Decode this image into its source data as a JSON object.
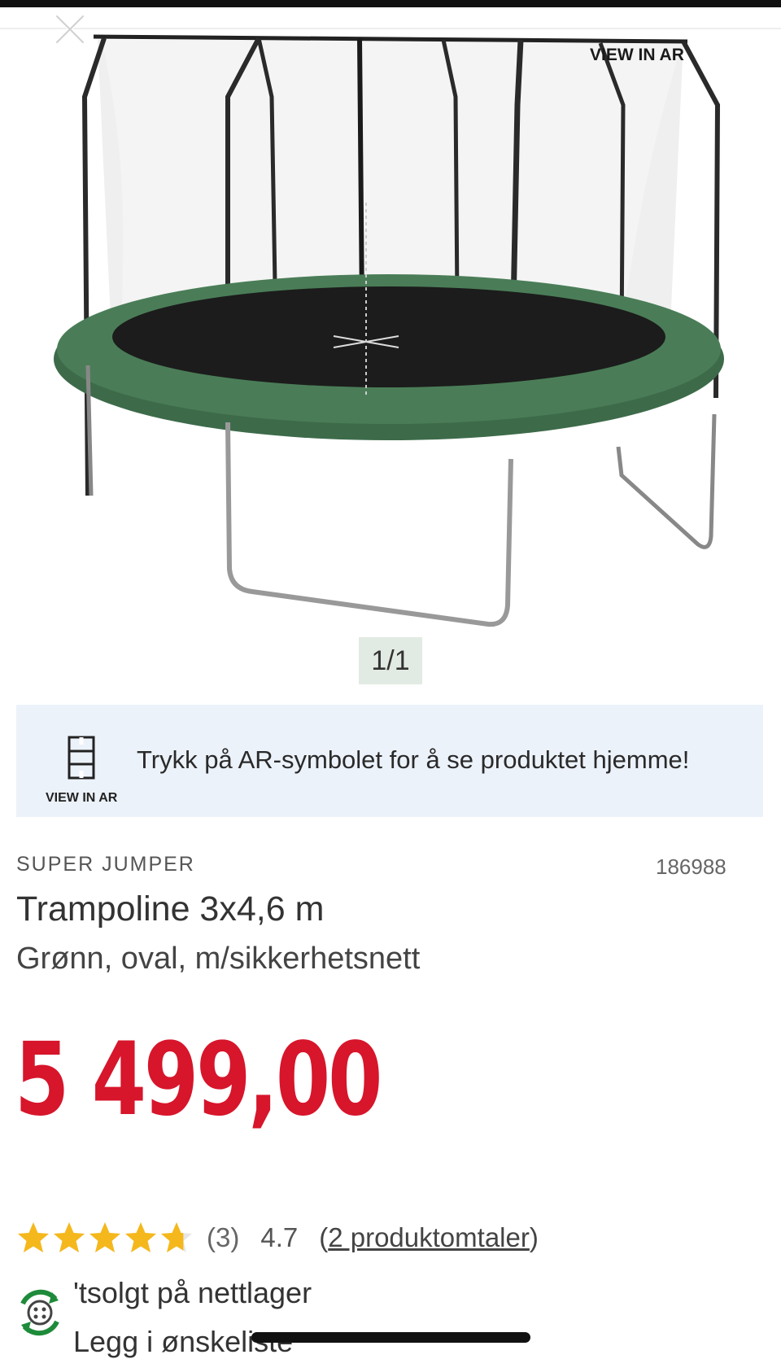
{
  "header": {
    "close_icon": "close-icon",
    "view_in_ar_label": "VIEW IN AR"
  },
  "gallery": {
    "pager": "1/1"
  },
  "ar_banner": {
    "icon": "ar-cube-icon",
    "icon_label": "VIEW IN AR",
    "text": "Trykk på AR-symbolet for å se produktet hjemme!"
  },
  "product": {
    "brand": "SUPER JUMPER",
    "sku": "186988",
    "title": "Trampoline 3x4,6 m",
    "subtitle": "Grønn, oval, m/sikkerhetsnett",
    "price": "5 499,00"
  },
  "rating": {
    "stars": 4.7,
    "count": "(3)",
    "value": "4.7",
    "reviews_prefix": "(",
    "reviews_link": "2 produktomtaler",
    "reviews_suffix": ")"
  },
  "availability": {
    "stock_text": "'tsolgt på nettlager",
    "wishlist_text": "Legg i ønskeliste"
  },
  "colors": {
    "price": "#d7152b",
    "star": "#f5b81c",
    "banner_bg": "#ecf2fa",
    "pager_bg": "#e2ebe3"
  }
}
